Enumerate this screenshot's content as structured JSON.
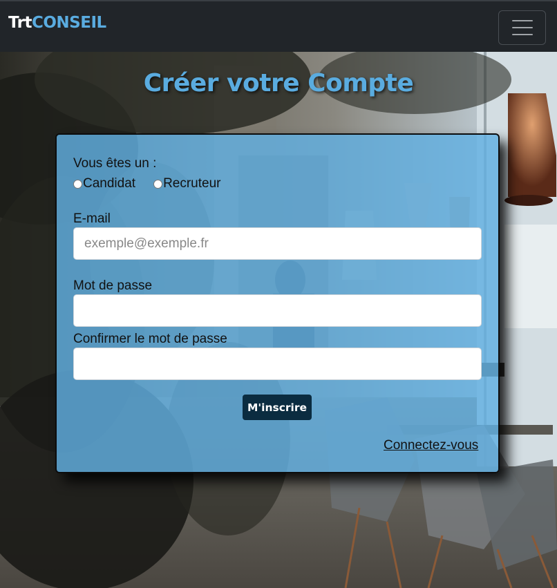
{
  "navbar": {
    "brand_part1": "Trt",
    "brand_part2": "CONSEIL",
    "toggler_icon": "hamburger-icon"
  },
  "page": {
    "title": "Créer votre Compte"
  },
  "form": {
    "role_label": "Vous êtes un :",
    "role_options": [
      "Candidat",
      "Recruteur"
    ],
    "email_label": "E-mail",
    "email_placeholder": "exemple@exemple.fr",
    "password_label": "Mot de passe",
    "password_value": "",
    "confirm_label": "Confirmer le mot de passe",
    "confirm_value": "",
    "submit_label": "M'inscrire",
    "login_link": "Connectez-vous"
  },
  "colors": {
    "navbar_bg": "#212529",
    "accent": "#5aace0",
    "card_bg": "#62b0e2",
    "button_bg": "#0b2c40"
  }
}
